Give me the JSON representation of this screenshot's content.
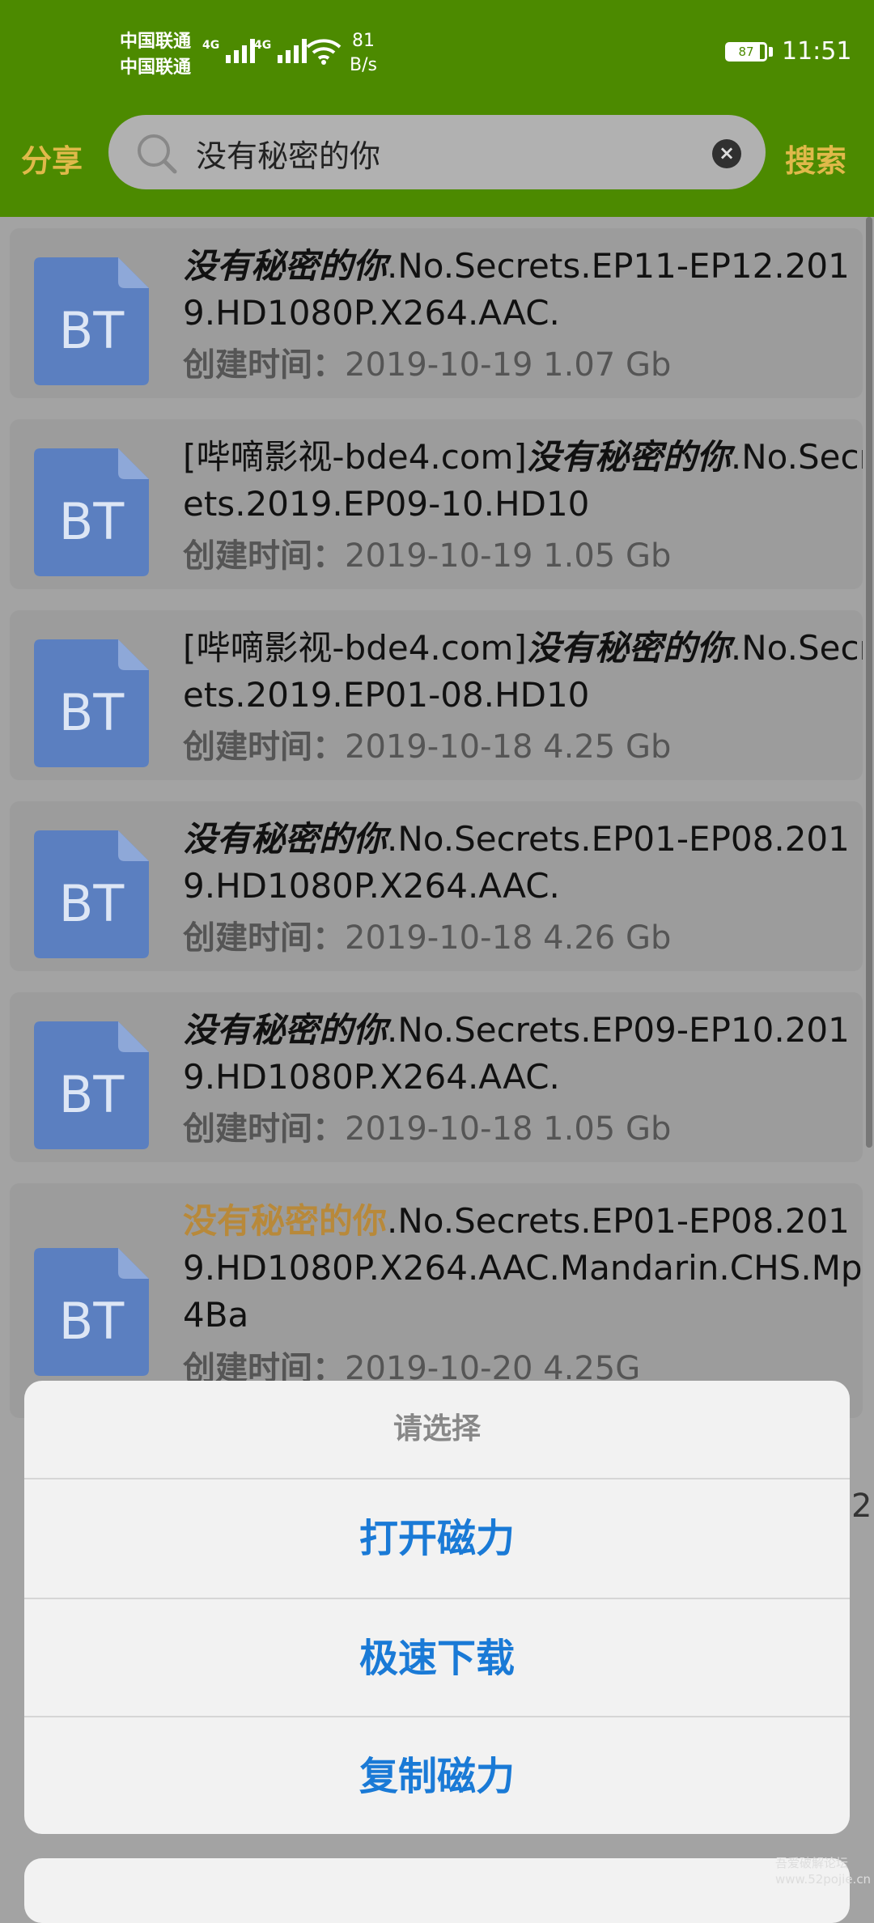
{
  "status_bar": {
    "carrier1": "中国联通",
    "carrier2": "中国联通",
    "net1": "4G",
    "net2": "4G",
    "speed_value": "81",
    "speed_unit": "B/s",
    "battery": "87",
    "time": "11:51"
  },
  "toolbar": {
    "share_label": "分享",
    "search_value": "没有秘密的你",
    "search_button": "搜索"
  },
  "results": [
    {
      "highlight": "没有秘密的你",
      "rest": ".No.Secrets.EP11-EP12.2019.HD1080P.X264.AAC.",
      "meta_label": "创建时间：",
      "meta_value": "2019-10-19 1.07 Gb"
    },
    {
      "prefix": "[哔嘀影视-bde4.com]",
      "highlight": "没有秘密的你",
      "rest": ".No.Secrets.2019.EP09-10.HD10",
      "meta_label": "创建时间：",
      "meta_value": "2019-10-19 1.05 Gb"
    },
    {
      "prefix": "[哔嘀影视-bde4.com]",
      "highlight": "没有秘密的你",
      "rest": ".No.Secrets.2019.EP01-08.HD10",
      "meta_label": "创建时间：",
      "meta_value": "2019-10-18 4.25 Gb"
    },
    {
      "highlight": "没有秘密的你",
      "rest": ".No.Secrets.EP01-EP08.2019.HD1080P.X264.AAC.",
      "meta_label": "创建时间：",
      "meta_value": "2019-10-18 4.26 Gb"
    },
    {
      "highlight": "没有秘密的你",
      "rest": ".No.Secrets.EP09-EP10.2019.HD1080P.X264.AAC.",
      "meta_label": "创建时间：",
      "meta_value": "2019-10-18 1.05 Gb"
    },
    {
      "highlight": "没有秘密的你",
      "rest": ".No.Secrets.EP01-EP08.2019.HD1080P.X264.AAC.Mandarin.CHS.Mp4Ba",
      "meta_label": "创建时间：",
      "meta_value": "2019-10-20 4.25G"
    }
  ],
  "bt_icon_label": "BT",
  "action_sheet": {
    "title": "请选择",
    "options": [
      "打开磁力",
      "极速下载",
      "复制磁力"
    ]
  },
  "stray_char": "2",
  "watermark": "吾爱破解论坛 www.52pojie.cn",
  "colors": {
    "bar_green": "#4c8a00",
    "accent_gold": "#e0b94a",
    "option_blue": "#1a7ad6",
    "bt_blue": "#5b7fc0"
  }
}
